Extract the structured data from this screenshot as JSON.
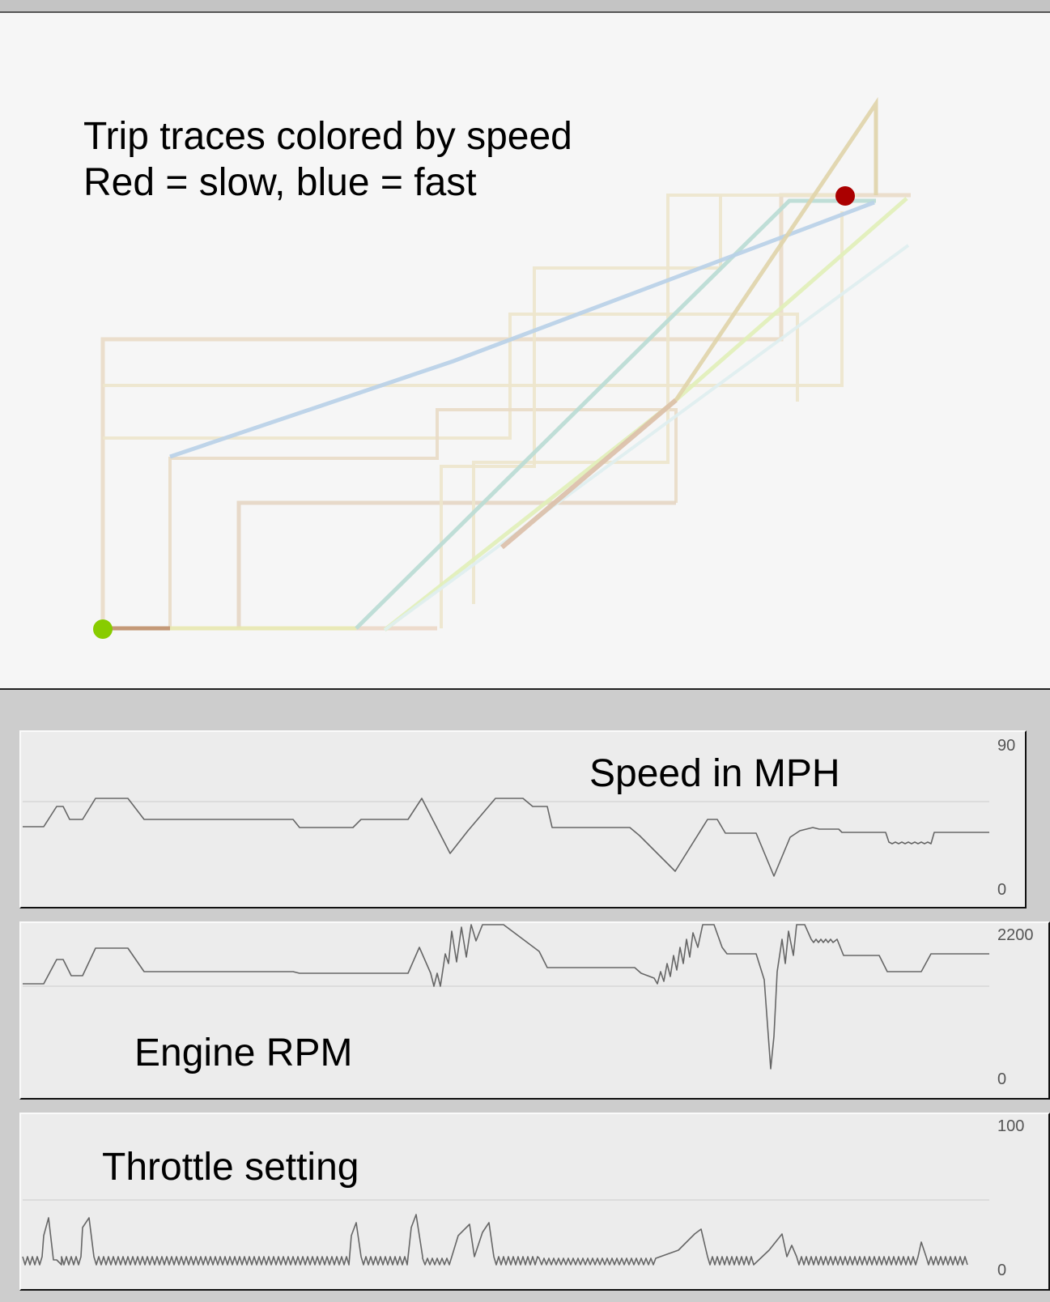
{
  "map": {
    "title_line1": "Trip traces colored by speed",
    "title_line2": "Red = slow, blue = fast",
    "colors": {
      "start": "#88cc00",
      "end": "#aa0000",
      "slow": "#c8a890",
      "mid": "#e8e8b0",
      "fast": "#b8d0e8"
    }
  },
  "gauges": {
    "speed": {
      "label": "Speed in MPH",
      "max": "90",
      "min": "0"
    },
    "rpm": {
      "label": "Engine  RPM",
      "max": "2200",
      "min": "0"
    },
    "throttle": {
      "label": "Throttle setting",
      "max": "100",
      "min": "0"
    }
  }
}
